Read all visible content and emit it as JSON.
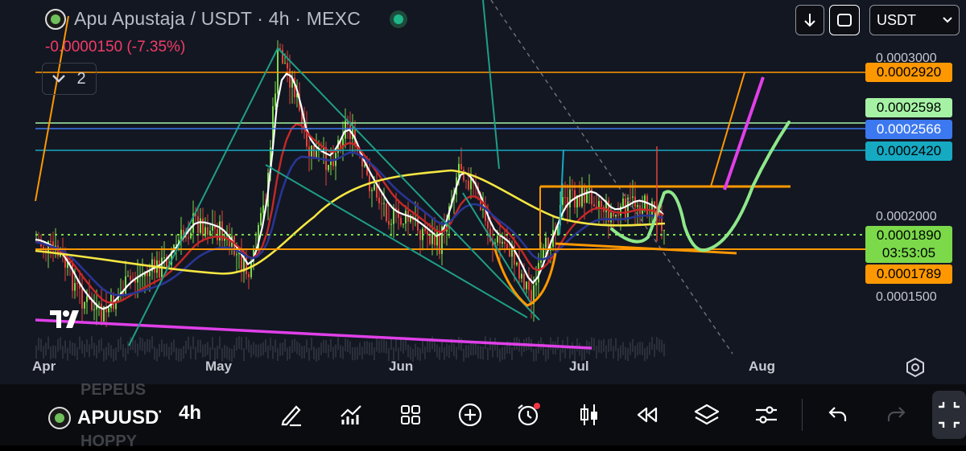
{
  "header": {
    "title": "Apu Apustaja / USDT · 4h · MEXC",
    "change": "-0.0000150 (-7.35%)",
    "indicator_count": "2",
    "symbol_select": "USDT"
  },
  "price_axis": {
    "labels": [
      "0.0003000",
      "0.0002000",
      "0.0001500"
    ]
  },
  "price_tags": [
    {
      "name": "orange-level-high",
      "value": "0.0002920",
      "color": "#ff9800"
    },
    {
      "name": "green-level",
      "value": "0.0002598",
      "color": "#a5f2a5"
    },
    {
      "name": "blue-level",
      "value": "0.0002566",
      "color": "#3c78f0"
    },
    {
      "name": "teal-level",
      "value": "0.0002420",
      "color": "#16a9c2"
    },
    {
      "name": "current-price",
      "value": "0.0001890",
      "countdown": "03:53:05",
      "color": "#7bd94a"
    },
    {
      "name": "orange-level-low",
      "value": "0.0001789",
      "color": "#ff9800"
    }
  ],
  "time_axis": {
    "labels": [
      "Apr",
      "May",
      "Jun",
      "Jul",
      "Aug"
    ]
  },
  "toolbar": {
    "symbol": "APUUSDT",
    "timeframe": "4h",
    "ghost_symbols": [
      "PEPEUS",
      "HOPPY"
    ],
    "icons": [
      "pen-icon",
      "indicators-icon",
      "grid-icon",
      "plus-circle-icon",
      "alert-clock-icon",
      "candles-icon",
      "replay-icon",
      "layers-icon",
      "settings-icon",
      "undo-icon",
      "redo-icon"
    ]
  },
  "colors": {
    "background": "#131722",
    "up": "#7bd94a",
    "down": "#e0433b",
    "accent_magenta": "#e040e8"
  }
}
